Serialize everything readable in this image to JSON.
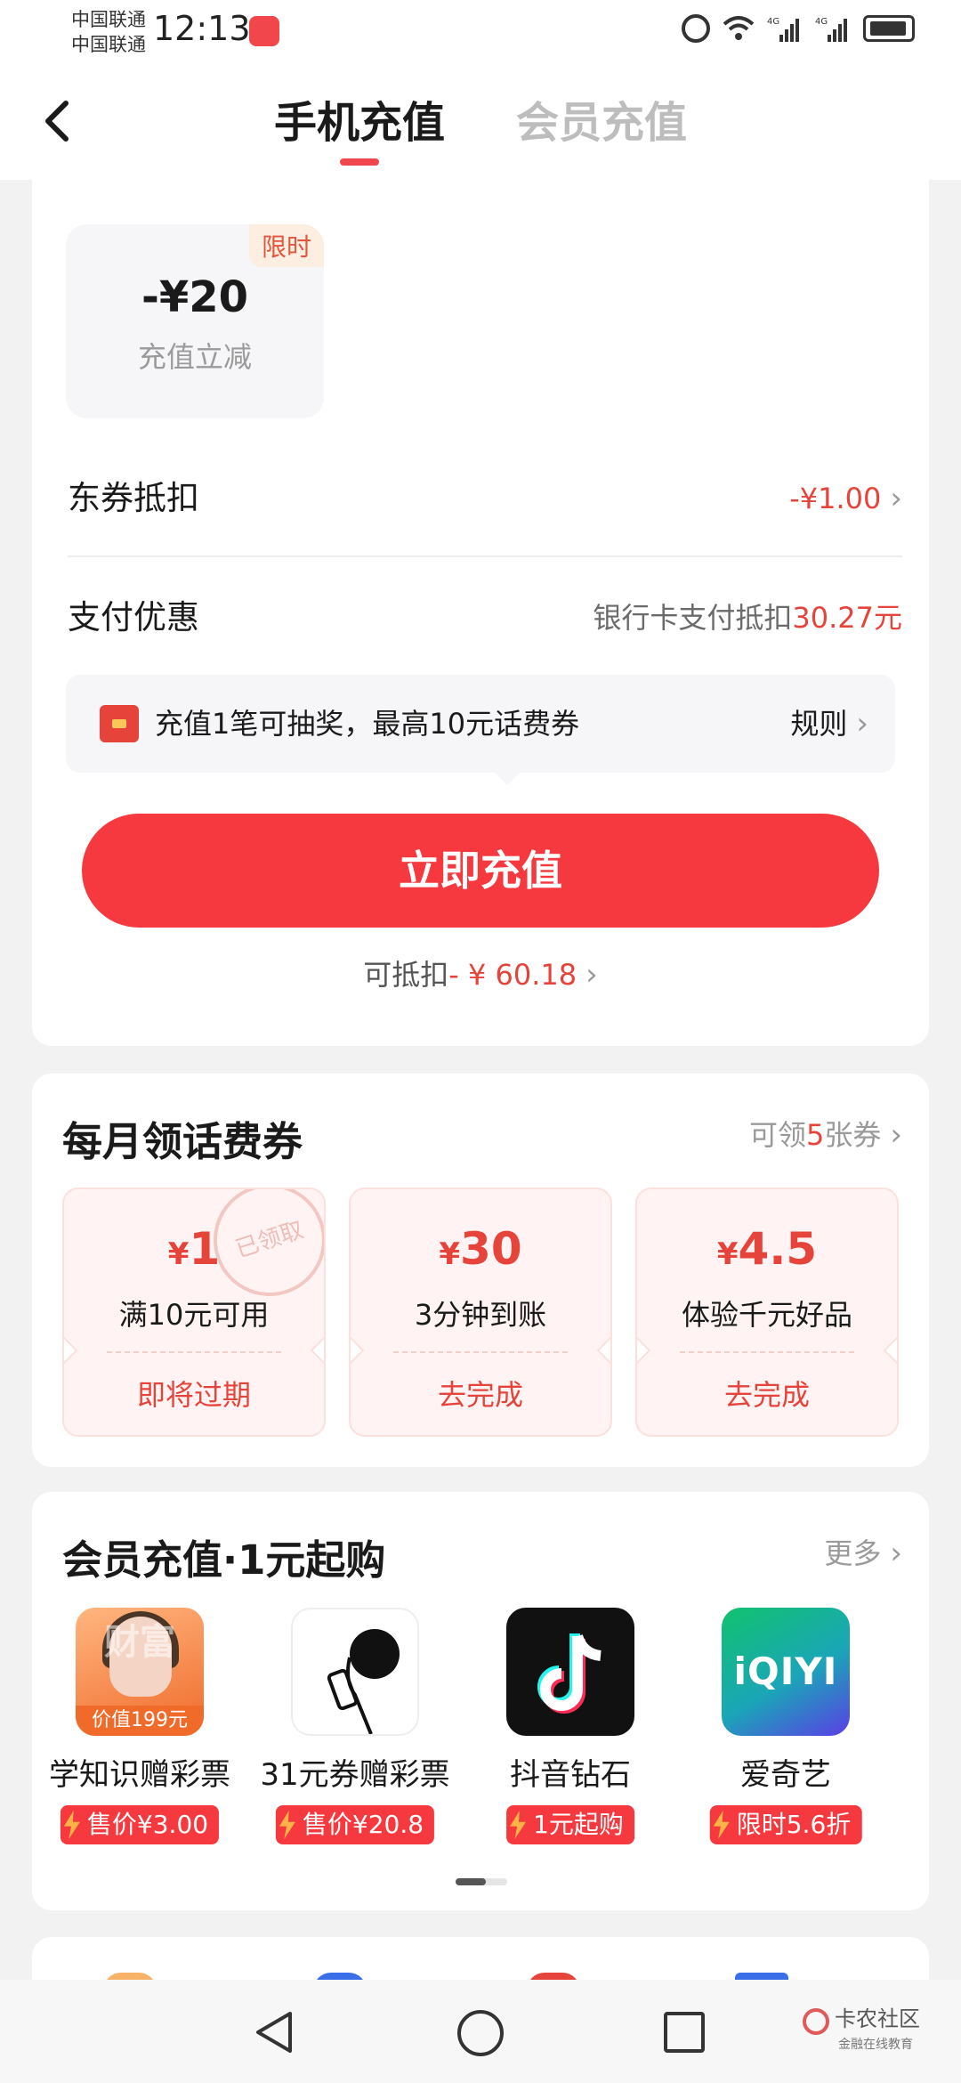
{
  "status_bar": {
    "carrier_1": "中国联通",
    "carrier_2": "中国联通",
    "time": "12:13",
    "signal_1": "4G",
    "signal_2": "4G"
  },
  "header": {
    "tabs": [
      {
        "label": "手机充值",
        "active": true
      },
      {
        "label": "会员充值",
        "active": false
      }
    ]
  },
  "recharge": {
    "discount_badge": "限时",
    "discount_amount": "-¥20",
    "discount_label": "充值立减",
    "jd_coupon": {
      "label": "东券抵扣",
      "value": "-¥1.00"
    },
    "payment": {
      "label": "支付优惠",
      "desc": "银行卡支付抵扣",
      "amount": "30.27元"
    },
    "lottery": {
      "text": "充值1笔可抽奖，最高10元话费券",
      "rules": "规则"
    },
    "button": "立即充值",
    "deduct_prefix": "可抵扣",
    "deduct_value": "- ¥ 60.18"
  },
  "coupons": {
    "title": "每月领话费券",
    "link_prefix": "可领",
    "link_count": "5",
    "link_suffix": "张券",
    "items": [
      {
        "currency": "¥",
        "amount": "1",
        "condition": "满10元可用",
        "action": "即将过期",
        "stamp": "已领取"
      },
      {
        "currency": "¥",
        "amount": "30",
        "condition": "3分钟到账",
        "action": "去完成"
      },
      {
        "currency": "¥",
        "amount": "4.5",
        "condition": "体验千元好品",
        "action": "去完成"
      }
    ]
  },
  "member": {
    "title": "会员充值·1元起购",
    "more": "更多",
    "products": [
      {
        "name": "学知识赠彩票",
        "tag": "售价¥3.00",
        "image_text_1": "财富",
        "image_text_2": "价值199元",
        "icon": "knowledge-course-icon"
      },
      {
        "name": "31元券赠彩票",
        "tag": "售价¥20.8",
        "icon": "drinking-figure-icon"
      },
      {
        "name": "抖音钻石",
        "tag": "1元起购",
        "icon": "douyin-icon"
      },
      {
        "name": "爱奇艺",
        "tag": "限时5.6折",
        "image_text": "iQIYI",
        "icon": "iqiyi-icon"
      }
    ]
  },
  "watermark": {
    "text_1": "卡农社区",
    "text_2": "金融在线教育"
  },
  "colors": {
    "accent": "#f6393f",
    "price_red": "#e6443b",
    "muted": "#9a9a9a",
    "background": "#f2f2f2"
  }
}
